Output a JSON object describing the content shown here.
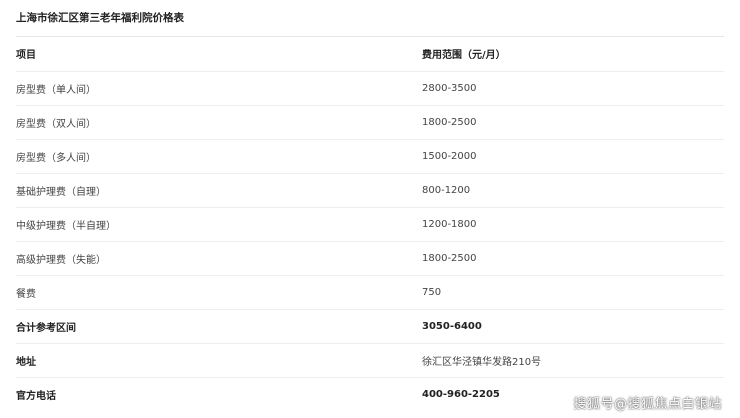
{
  "table": {
    "caption": "上海市徐汇区第三老年福利院价格表",
    "headers": [
      "项目",
      "费用范围（元/月）"
    ],
    "rows": [
      {
        "item": "房型费（单人间）",
        "value": "2800-3500"
      },
      {
        "item": "房型费（双人间）",
        "value": "1800-2500"
      },
      {
        "item": "房型费（多人间）",
        "value": "1500-2000"
      },
      {
        "item": "基础护理费（自理）",
        "value": "800-1200"
      },
      {
        "item": "中级护理费（半自理）",
        "value": "1200-1800"
      },
      {
        "item": "高级护理费（失能）",
        "value": "1800-2500"
      },
      {
        "item": "餐费",
        "value": "750"
      },
      {
        "item": "合计参考区间",
        "value": "3050-6400"
      },
      {
        "item": "地址",
        "value": "徐汇区华泾镇华发路210号"
      },
      {
        "item": "官方电话",
        "value": "400-960-2205"
      }
    ]
  },
  "watermark": "搜狐号@搜狐焦点白银站"
}
